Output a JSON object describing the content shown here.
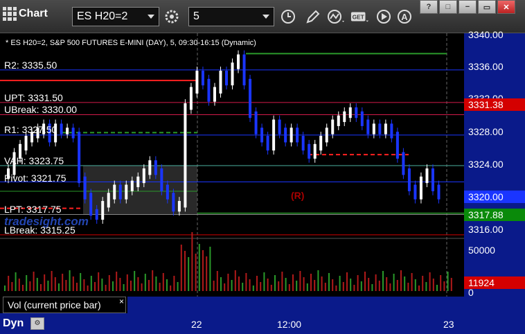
{
  "toolbar": {
    "app_title": "Chart",
    "symbol": "ES H20=2",
    "interval": "5",
    "icons": [
      "settings-icon",
      "clock-icon",
      "pencil-icon",
      "indicator-icon",
      "get-icon",
      "play-icon",
      "a-icon"
    ],
    "window_buttons": [
      "?",
      "□",
      "−",
      "▭",
      "✕"
    ]
  },
  "chart": {
    "header": "* ES H20=2, S&P 500 FUTURES E-MINI (DAY), 5, 09:30-16:15 (Dynamic)",
    "levels": {
      "r2": "R2: 3335.50",
      "upt": "UPT: 3331.50",
      "ubreak": "UBreak: 3330.00",
      "r1": "R1: 3327.50",
      "vah": "VAH: 3323.75",
      "pivot": "Pivot: 3321.75",
      "lpt": "LPT: 3317.75",
      "lbreak": "LBreak: 3315.25"
    },
    "r_mark": "(R)",
    "watermark": "tradesight.com",
    "price_axis": [
      "3340.00",
      "3336.00",
      "3332.00",
      "3328.00",
      "3324.00",
      "3320.00",
      "3316.00"
    ],
    "price_tags": {
      "upper": "3331.38",
      "current": "3320.00",
      "lower": "3317.88"
    },
    "colors": {
      "bg": "#000000",
      "axis": "#0a1a8a",
      "candle_up": "#ffffff",
      "candle_down": "#1a35ff",
      "red_tag": "#d40000",
      "green_tag": "#0a8a0a"
    }
  },
  "volume": {
    "panel_label": "Vol (current price bar)",
    "close_label": "×",
    "axis_labels": [
      "50000",
      "0"
    ],
    "current_tag": "11924"
  },
  "time_axis": {
    "labels": [
      "22",
      "12:00",
      "23"
    ],
    "dyn_label": "Dyn"
  }
}
